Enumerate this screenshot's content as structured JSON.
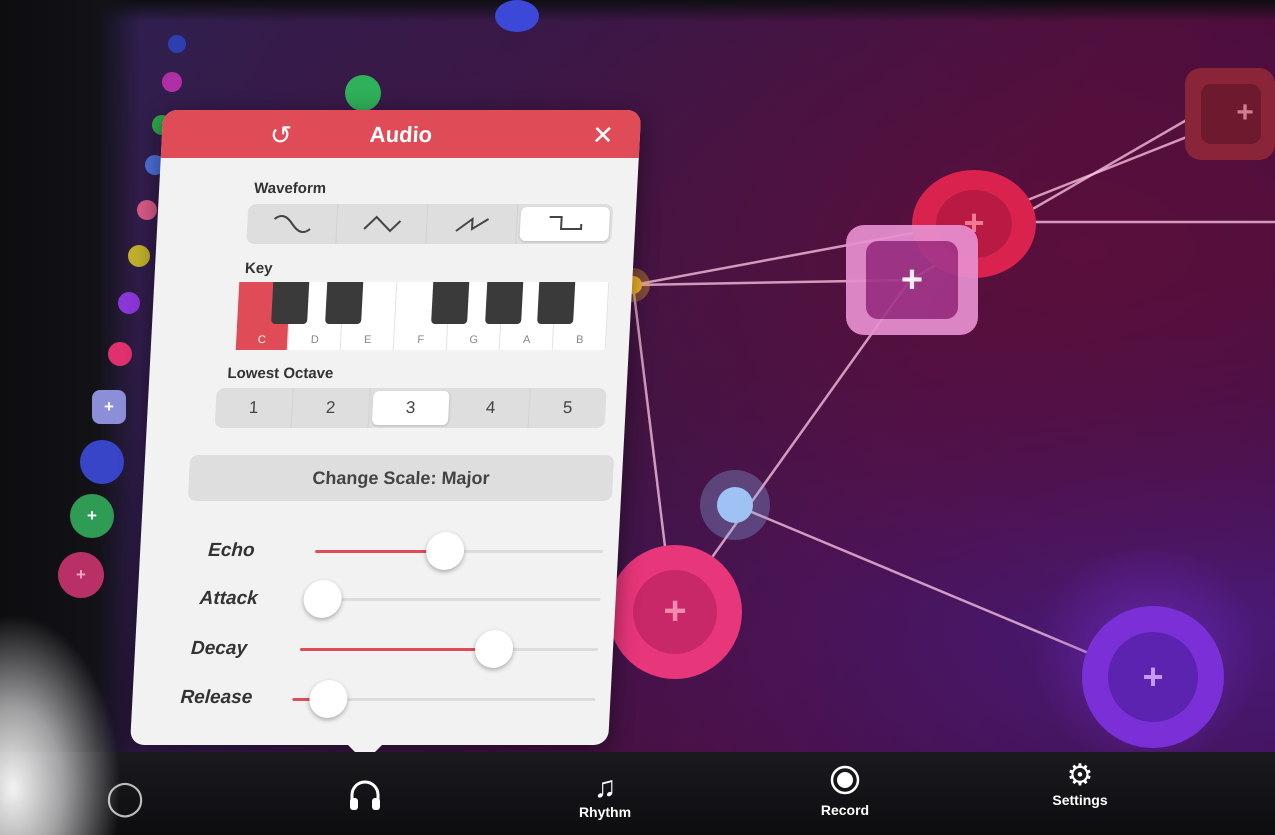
{
  "colors": {
    "accent": "#df4c58",
    "panel_bg": "#f2f2f2",
    "node_pink": "#e8367a",
    "node_red": "#d9234e",
    "node_purple": "#7b2fd6",
    "node_blue": "#8fb6f0",
    "node_yellow": "#f0b32a"
  },
  "audio_panel": {
    "title": "Audio",
    "reset_icon": "rotate-left-icon",
    "close_icon": "close-icon",
    "waveform": {
      "label": "Waveform",
      "options": [
        "sine-wave-icon",
        "triangle-wave-icon",
        "sawtooth-wave-icon",
        "square-wave-icon"
      ],
      "selected_index": 3
    },
    "key": {
      "label": "Key",
      "notes": [
        "C",
        "D",
        "E",
        "F",
        "G",
        "A",
        "B"
      ],
      "selected": "C"
    },
    "lowest_octave": {
      "label": "Lowest Octave",
      "options": [
        "1",
        "2",
        "3",
        "4",
        "5"
      ],
      "selected": "3"
    },
    "scale_button": "Change Scale: Major",
    "sliders": {
      "echo": {
        "label": "Echo",
        "value": 0.45
      },
      "attack": {
        "label": "Attack",
        "value": 0.05
      },
      "decay": {
        "label": "Decay",
        "value": 0.65
      },
      "release": {
        "label": "Release",
        "value": 0.12
      }
    }
  },
  "bottom_bar": {
    "tabs": [
      {
        "label": "",
        "icon": "circle-icon"
      },
      {
        "label": "",
        "icon": "headphones-icon",
        "active": true
      },
      {
        "label": "Rhythm",
        "icon": "music-note-icon"
      },
      {
        "label": "Record",
        "icon": "record-icon"
      },
      {
        "label": "Settings",
        "icon": "gear-icon"
      }
    ]
  }
}
